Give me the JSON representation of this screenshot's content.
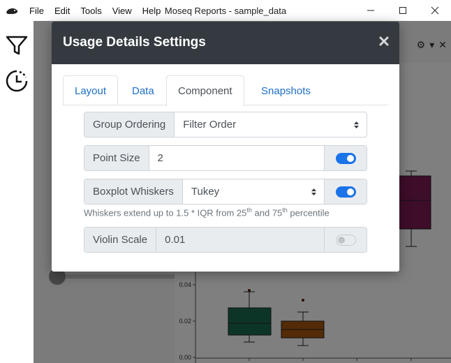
{
  "window": {
    "title": "Moseq Reports - sample_data",
    "menu": [
      "File",
      "Edit",
      "Tools",
      "View",
      "Help"
    ]
  },
  "rail": {
    "icons": [
      "filter-icon",
      "history-icon"
    ]
  },
  "plot": {
    "y_ticks": [
      "0.04",
      "0.02",
      "0.00"
    ],
    "box_colors": [
      "#1a6b4f",
      "#a8570f",
      "#7d1a52"
    ]
  },
  "modal": {
    "title": "Usage Details Settings",
    "close_glyph": "×",
    "tabs": [
      {
        "label": "Layout",
        "active": false
      },
      {
        "label": "Data",
        "active": false
      },
      {
        "label": "Component",
        "active": true
      },
      {
        "label": "Snapshots",
        "active": false
      }
    ],
    "group_ordering": {
      "label": "Group Ordering",
      "value": "Filter Order"
    },
    "point_size": {
      "label": "Point Size",
      "value": "2",
      "enabled": true
    },
    "boxplot_whiskers": {
      "label": "Boxplot Whiskers",
      "value": "Tukey",
      "enabled": true,
      "help_prefix": "Whiskers extend up to 1.5 * IQR from 25",
      "help_sup1": "th",
      "help_mid": " and 75",
      "help_sup2": "th",
      "help_suffix": " percentile"
    },
    "violin_scale": {
      "label": "Violin Scale",
      "value": "0.01",
      "enabled": false
    }
  },
  "colors": {
    "header_bg": "#343a40",
    "accent": "#1a73e8",
    "link": "#1f6fc5"
  }
}
